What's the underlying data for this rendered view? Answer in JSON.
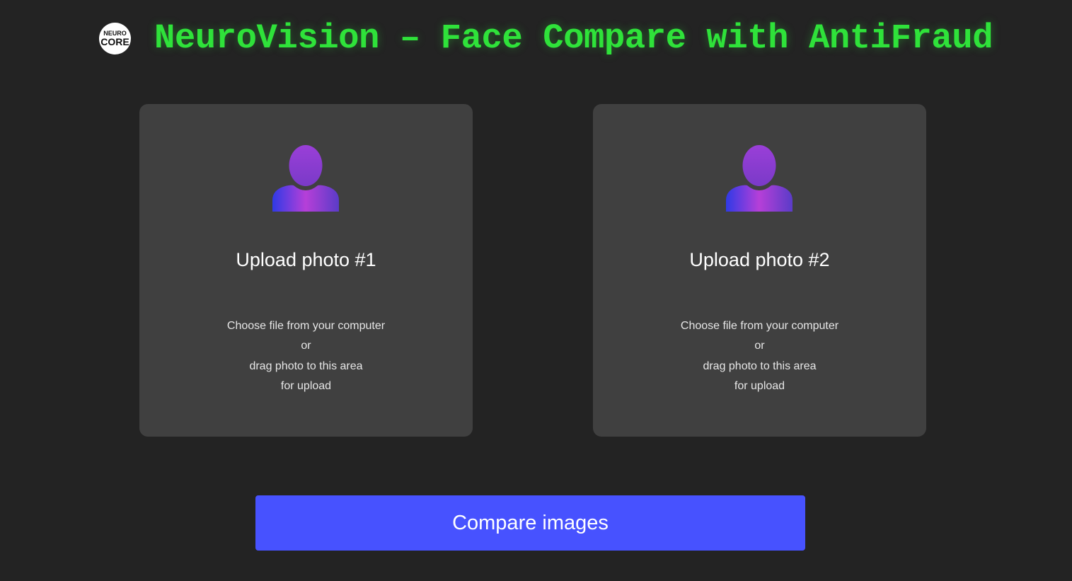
{
  "header": {
    "logo_line1": "NEURO",
    "logo_line2": "CORE",
    "title": "NeuroVision – Face Compare with AntiFraud"
  },
  "uploads": [
    {
      "icon": "person-silhouette-icon",
      "title": "Upload photo #1",
      "hint": [
        "Choose file from your computer",
        "or",
        "drag photo to this area",
        "for upload"
      ]
    },
    {
      "icon": "person-silhouette-icon",
      "title": "Upload photo #2",
      "hint": [
        "Choose file from your computer",
        "or",
        "drag photo to this area",
        "for upload"
      ]
    }
  ],
  "compare_button": {
    "label": "Compare images"
  },
  "colors": {
    "background": "#232323",
    "card": "#404040",
    "title_green": "#2fe23a",
    "button_blue": "#4752ff",
    "avatar_gradient": [
      "#2f3ae6",
      "#b83fd6",
      "#6a3fd0"
    ]
  }
}
